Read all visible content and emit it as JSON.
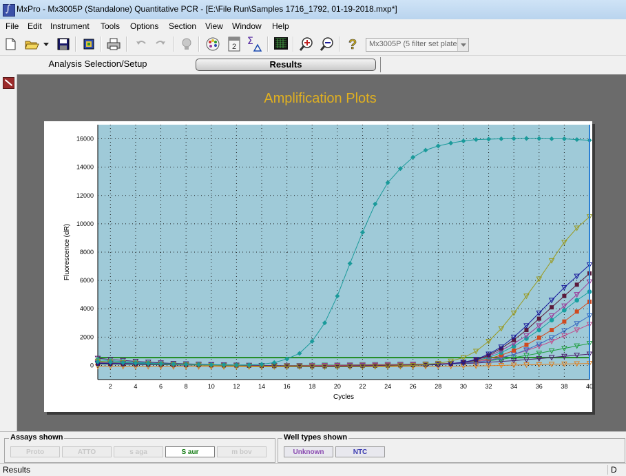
{
  "window": {
    "title": "MxPro - Mx3005P (Standalone) Quantitative PCR - [E:\\File Run\\Samples 1716_1792, 01-19-2018.mxp*]"
  },
  "menu": [
    "File",
    "Edit",
    "Instrument",
    "Tools",
    "Options",
    "Section",
    "View",
    "Window",
    "Help"
  ],
  "toolbar": {
    "icons": [
      "new-file-icon",
      "open-folder-icon",
      "dropdown-arrow-icon",
      "save-icon",
      "export-icon",
      "print-icon",
      "undo-icon",
      "redo-icon",
      "lightbulb-icon",
      "palette-icon",
      "page-number-icon",
      "sigma-delta-icon",
      "grid-icon",
      "zoom-in-icon",
      "zoom-out-icon",
      "help-icon"
    ],
    "page_number_label": "2",
    "instrument_select": "Mx3005P (5 filter set plate)"
  },
  "tabs": {
    "analysis": "Analysis Selection/Setup",
    "results": "Results"
  },
  "plot": {
    "title": "Amplification Plots"
  },
  "assays": {
    "legend": "Assays shown",
    "items": [
      {
        "label": "Proto",
        "active": false
      },
      {
        "label": "ATTO",
        "active": false
      },
      {
        "label": "s aga",
        "active": false
      },
      {
        "label": "S aur",
        "active": true
      },
      {
        "label": "m bov",
        "active": false
      }
    ]
  },
  "well_types": {
    "legend": "Well types shown",
    "items": [
      {
        "label": "Unknown",
        "color": "#8a4ab0"
      },
      {
        "label": "NTC",
        "color": "#3b3bb0"
      }
    ]
  },
  "status": {
    "text": "Results",
    "right": "D"
  },
  "colors": {
    "plot_bg": "#9fcad8",
    "title": "#e0b020",
    "threshold": "#1e8a1e",
    "cursor": "#2a7fd4"
  },
  "chart_data": {
    "type": "line",
    "title": "Amplification Plots",
    "xlabel": "Cycles",
    "ylabel": "Fluorescence (dR)",
    "xlim": [
      1,
      40
    ],
    "ylim": [
      -1000,
      17000
    ],
    "xticks": [
      2,
      4,
      6,
      8,
      10,
      12,
      14,
      16,
      18,
      20,
      22,
      24,
      26,
      28,
      30,
      32,
      34,
      36,
      38,
      40
    ],
    "yticks": [
      0,
      2000,
      4000,
      6000,
      8000,
      10000,
      12000,
      14000,
      16000
    ],
    "grid": true,
    "threshold": 550,
    "series": [
      {
        "color": "#1a9a9a",
        "marker": "diamond",
        "values": [
          250,
          220,
          190,
          160,
          130,
          110,
          90,
          70,
          60,
          50,
          40,
          30,
          40,
          80,
          200,
          450,
          850,
          1700,
          3000,
          4900,
          7200,
          9400,
          11400,
          12900,
          13900,
          14700,
          15200,
          15500,
          15700,
          15850,
          15950,
          15980,
          16000,
          16020,
          16030,
          16020,
          16000,
          16000,
          15950,
          15900
        ]
      },
      {
        "color": "#9a9a20",
        "marker": "triangle-down",
        "values": [
          300,
          250,
          200,
          160,
          120,
          80,
          60,
          40,
          20,
          0,
          -20,
          -30,
          -40,
          -50,
          -60,
          -70,
          -80,
          -90,
          -100,
          -100,
          -90,
          -80,
          -60,
          -40,
          -20,
          0,
          50,
          150,
          300,
          550,
          1000,
          1700,
          2600,
          3700,
          4900,
          6100,
          7400,
          8700,
          9700,
          10500
        ]
      },
      {
        "color": "#1a1a9a",
        "marker": "triangle-down",
        "values": [
          150,
          140,
          120,
          100,
          80,
          60,
          40,
          30,
          20,
          10,
          0,
          -10,
          -20,
          -30,
          -40,
          -50,
          -60,
          -70,
          -80,
          -80,
          -70,
          -60,
          -50,
          -40,
          -20,
          0,
          30,
          60,
          120,
          220,
          420,
          800,
          1300,
          2000,
          2800,
          3700,
          4600,
          5500,
          6300,
          7100
        ]
      },
      {
        "color": "#5a1a3a",
        "marker": "square",
        "values": [
          120,
          110,
          100,
          90,
          70,
          60,
          40,
          30,
          20,
          10,
          0,
          -10,
          -20,
          -30,
          -40,
          -50,
          -60,
          -60,
          -60,
          -50,
          -40,
          -30,
          -20,
          -10,
          0,
          20,
          40,
          70,
          120,
          200,
          380,
          720,
          1200,
          1800,
          2500,
          3300,
          4100,
          4900,
          5700,
          6500
        ]
      },
      {
        "color": "#9a3a9a",
        "marker": "triangle-down",
        "values": [
          180,
          160,
          140,
          110,
          90,
          70,
          50,
          40,
          30,
          20,
          10,
          0,
          -10,
          -20,
          -30,
          -40,
          -40,
          -40,
          -40,
          -30,
          -20,
          -10,
          0,
          10,
          20,
          40,
          60,
          90,
          140,
          220,
          380,
          650,
          1050,
          1550,
          2100,
          2800,
          3500,
          4200,
          5000,
          5900
        ]
      },
      {
        "color": "#17a0a0",
        "marker": "circle",
        "values": [
          400,
          330,
          270,
          220,
          170,
          130,
          100,
          80,
          60,
          40,
          20,
          0,
          -20,
          -30,
          -40,
          -50,
          -50,
          -50,
          -40,
          -30,
          -20,
          -10,
          0,
          10,
          20,
          40,
          60,
          90,
          140,
          210,
          330,
          560,
          900,
          1350,
          1900,
          2500,
          3200,
          3900,
          4600,
          5200
        ]
      },
      {
        "color": "#d04a20",
        "marker": "square",
        "values": [
          200,
          180,
          160,
          130,
          110,
          90,
          70,
          50,
          30,
          20,
          10,
          0,
          -10,
          -20,
          -30,
          -30,
          -30,
          -30,
          -20,
          -10,
          0,
          10,
          20,
          30,
          40,
          60,
          80,
          110,
          150,
          210,
          310,
          480,
          720,
          1050,
          1450,
          1950,
          2500,
          3100,
          3800,
          4500
        ]
      },
      {
        "color": "#3a6ac0",
        "marker": "triangle-down",
        "values": [
          250,
          220,
          190,
          160,
          130,
          100,
          80,
          60,
          40,
          20,
          0,
          -20,
          -30,
          -40,
          -50,
          -50,
          -50,
          -40,
          -30,
          -20,
          -10,
          0,
          10,
          20,
          30,
          40,
          60,
          80,
          110,
          150,
          220,
          340,
          520,
          780,
          1100,
          1500,
          1950,
          2450,
          2950,
          3500
        ]
      },
      {
        "color": "#c04a8a",
        "marker": "triangle-down",
        "values": [
          150,
          140,
          130,
          120,
          100,
          80,
          60,
          40,
          20,
          10,
          0,
          -10,
          -20,
          -20,
          -20,
          -20,
          -20,
          -10,
          0,
          10,
          20,
          30,
          40,
          50,
          60,
          70,
          90,
          110,
          140,
          190,
          260,
          380,
          560,
          780,
          1050,
          1350,
          1700,
          2100,
          2500,
          2900
        ]
      },
      {
        "color": "#20a040",
        "marker": "triangle-down",
        "values": [
          100,
          90,
          80,
          70,
          60,
          50,
          40,
          30,
          20,
          10,
          0,
          -10,
          -20,
          -20,
          -20,
          -10,
          0,
          10,
          20,
          30,
          40,
          50,
          60,
          70,
          80,
          90,
          100,
          120,
          150,
          190,
          250,
          330,
          430,
          560,
          700,
          860,
          1030,
          1200,
          1380,
          1550
        ]
      },
      {
        "color": "#e08020",
        "marker": "triangle-down",
        "values": [
          -60,
          -60,
          -70,
          -80,
          -80,
          -90,
          -90,
          -100,
          -100,
          -100,
          -100,
          -100,
          -100,
          -100,
          -100,
          -100,
          -100,
          -100,
          -100,
          -100,
          -100,
          -100,
          -90,
          -90,
          -80,
          -80,
          -70,
          -70,
          -60,
          -50,
          -40,
          -20,
          0,
          20,
          40,
          60,
          80,
          100,
          120,
          140
        ]
      },
      {
        "color": "#4a1a6a",
        "marker": "triangle-down",
        "values": [
          500,
          420,
          350,
          290,
          230,
          180,
          140,
          110,
          80,
          60,
          40,
          20,
          10,
          0,
          -10,
          -20,
          -20,
          -20,
          -20,
          -10,
          0,
          10,
          20,
          30,
          40,
          50,
          60,
          80,
          100,
          130,
          170,
          220,
          280,
          340,
          410,
          480,
          560,
          640,
          720,
          800
        ]
      }
    ]
  }
}
